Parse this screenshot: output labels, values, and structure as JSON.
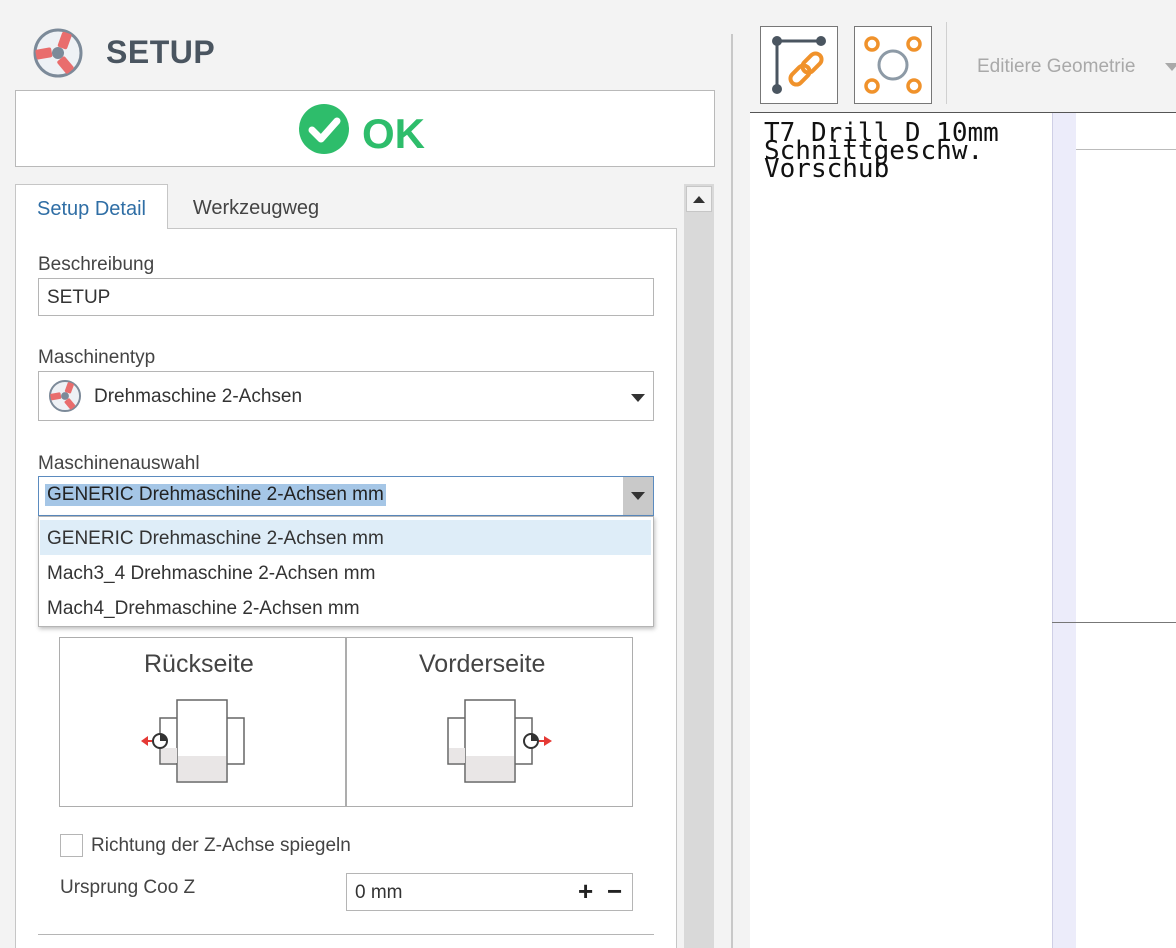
{
  "header": {
    "title": "SETUP",
    "ok_label": "OK"
  },
  "tabs": [
    {
      "label": "Setup Detail",
      "active": true
    },
    {
      "label": "Werkzeugweg",
      "active": false
    }
  ],
  "form": {
    "description_label": "Beschreibung",
    "description_value": "SETUP",
    "machine_type_label": "Maschinentyp",
    "machine_type_value": "Drehmaschine 2-Achsen",
    "machine_select_label": "Maschinenauswahl",
    "machine_select_value": "GENERIC Drehmaschine 2-Achsen mm",
    "machine_options": [
      "GENERIC Drehmaschine 2-Achsen mm",
      "Mach3_4 Drehmaschine 2-Achsen mm",
      "Mach4_Drehmaschine 2-Achsen mm"
    ],
    "side_back_label": "Rückseite",
    "side_front_label": "Vorderseite",
    "mirror_z_label": "Richtung der Z-Achse spiegeln",
    "mirror_z_checked": false,
    "origin_label": "Ursprung Coo Z",
    "origin_value": "0 mm",
    "plus_symbol": "+",
    "minus_symbol": "−"
  },
  "toolbar": {
    "tool1_icon": "chain-link-geometry-icon",
    "tool2_icon": "circle-pattern-icon",
    "edit_geometry_label": "Editiere Geometrie"
  },
  "canvas": {
    "lines": [
      "T7 Drill D 10mm",
      "Schnittgeschw.",
      "Vorschub"
    ]
  },
  "colors": {
    "ok_green": "#2ebd6b",
    "tab_blue": "#2f6ea5",
    "selection_blue": "#a5c6e6",
    "highlight_row": "#deedf8",
    "accent_orange": "#f0922b",
    "arrow_red": "#e53935"
  }
}
